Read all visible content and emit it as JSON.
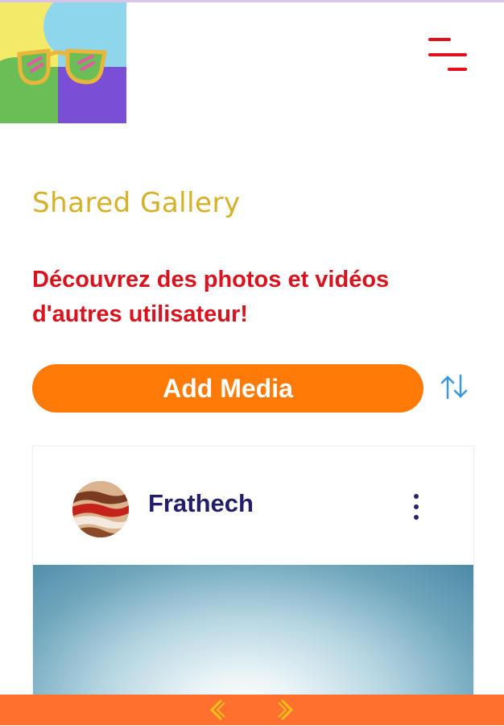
{
  "header": {
    "logo_icon": "sunglasses-logo-icon",
    "menu_icon": "hamburger-menu-icon"
  },
  "page": {
    "title": "Shared Gallery",
    "subtitle": "Découvrez des photos et vidéos d'autres utilisateur!"
  },
  "actions": {
    "add_media_label": "Add Media",
    "sort_icon": "sort-arrows-icon"
  },
  "post": {
    "username": "Frathech",
    "avatar_icon": "avatar-image",
    "more_icon": "more-vertical-icon"
  },
  "pager": {
    "prev_icon": "chevron-left-icon",
    "next_icon": "chevron-right-icon"
  },
  "colors": {
    "title": "#d6b027",
    "subtitle": "#d8131d",
    "accent_button": "#ff7a06",
    "bottom_bar": "#ff6f2e",
    "username": "#231d6b",
    "menu": "#e3101c"
  }
}
